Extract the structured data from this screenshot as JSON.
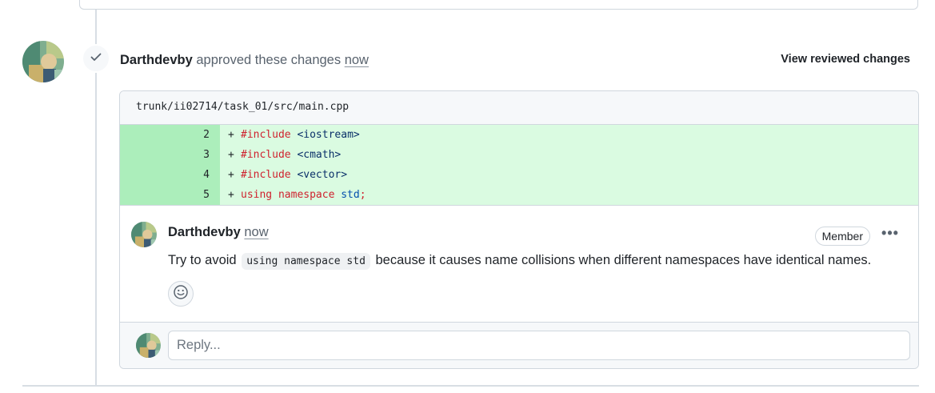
{
  "review": {
    "author": "Darthdevby",
    "action_text": "approved these changes",
    "time": "now",
    "view_reviewed_label": "View reviewed changes",
    "status_icon": "check-icon"
  },
  "diff": {
    "file_path": "trunk/ii02714/task_01/src/main.cpp",
    "added_color": "#dafbe1",
    "added_gutter_color": "#aceebb",
    "lines": [
      {
        "number": "2",
        "sign": "+",
        "tokens": [
          {
            "text": "#include",
            "kind": "kw"
          },
          {
            "text": " <iostream>",
            "kind": "str"
          }
        ]
      },
      {
        "number": "3",
        "sign": "+",
        "tokens": [
          {
            "text": "#include",
            "kind": "kw"
          },
          {
            "text": " <cmath>",
            "kind": "str"
          }
        ]
      },
      {
        "number": "4",
        "sign": "+",
        "tokens": [
          {
            "text": "#include",
            "kind": "kw"
          },
          {
            "text": " <vector>",
            "kind": "str"
          }
        ]
      },
      {
        "number": "5",
        "sign": "+",
        "tokens": [
          {
            "text": "using namespace",
            "kind": "kw"
          },
          {
            "text": " std",
            "kind": "nm"
          },
          {
            "text": ";",
            "kind": "kw"
          }
        ]
      }
    ]
  },
  "comment": {
    "author": "Darthdevby",
    "time": "now",
    "role_badge": "Member",
    "more_icon": "kebab-horizontal-icon",
    "body_before": "Try to avoid",
    "body_code": "using namespace std",
    "body_after": "because it causes name collisions when different namespaces have identical names.",
    "reaction_icon": "smiley-icon"
  },
  "reply": {
    "placeholder": "Reply..."
  }
}
